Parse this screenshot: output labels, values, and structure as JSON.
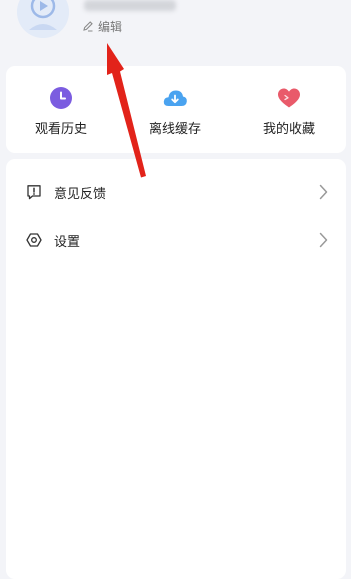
{
  "profile": {
    "edit_label": "编辑"
  },
  "quick_actions": [
    {
      "label": "观看历史",
      "icon": "clock-icon",
      "color": "#7b5ce0"
    },
    {
      "label": "离线缓存",
      "icon": "cloud-download-icon",
      "color": "#4aa3f0"
    },
    {
      "label": "我的收藏",
      "icon": "heart-icon",
      "color": "#e95a6a"
    }
  ],
  "menu": [
    {
      "label": "意见反馈",
      "icon": "feedback-icon"
    },
    {
      "label": "设置",
      "icon": "settings-icon"
    }
  ],
  "colors": {
    "background": "#f3f4f8",
    "annotation_arrow": "#e2231a"
  }
}
